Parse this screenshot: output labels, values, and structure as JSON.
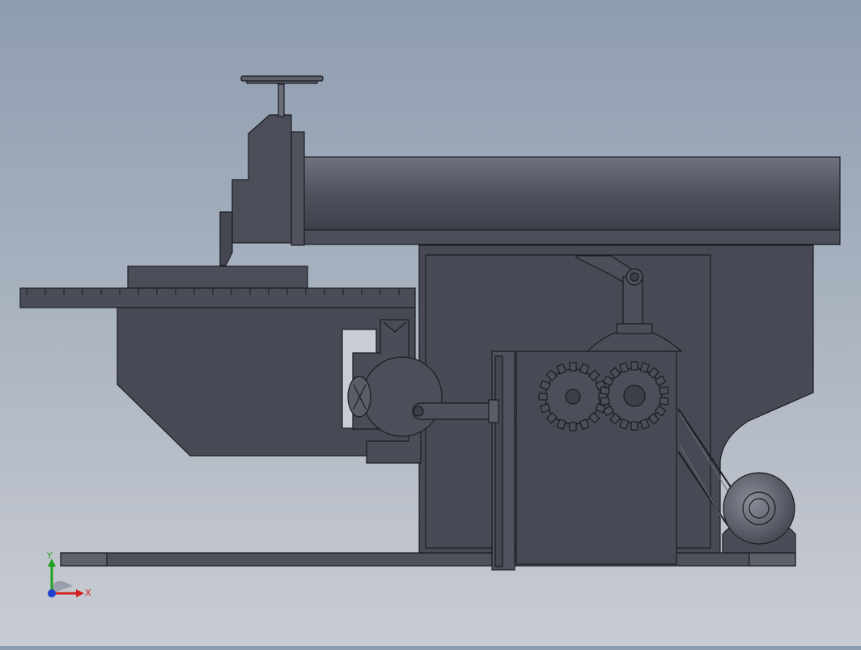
{
  "viewport": {
    "model": "shaper-machine-assembly",
    "view": "front",
    "colors": {
      "background_top": "#8e9db0",
      "background_bottom": "#c9ccd3",
      "body": "#4a4d57",
      "body_dark": "#3c3f48",
      "edge": "#1a1c22",
      "ram_light": "#6a6d79"
    }
  },
  "triad": {
    "x_label": "X",
    "y_label": "Y",
    "x_color": "#d02020",
    "y_color": "#20a020",
    "z_color": "#2040d0"
  }
}
